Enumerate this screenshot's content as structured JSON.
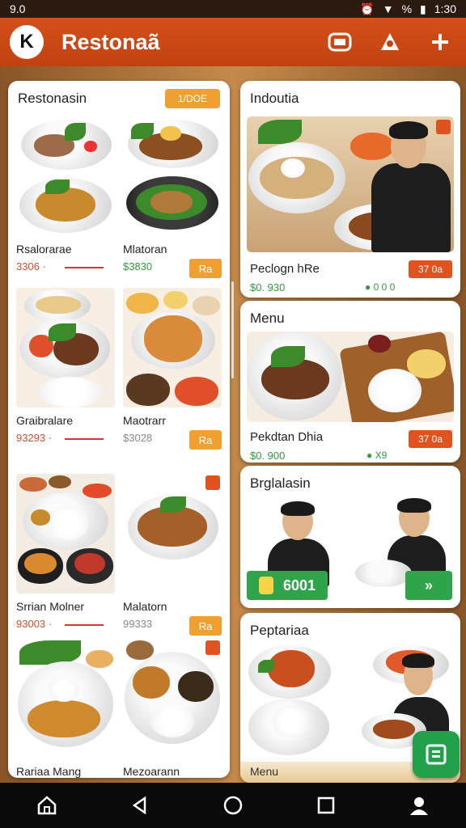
{
  "status": {
    "time": "1:30",
    "left_icons": "9.0",
    "battery": "%"
  },
  "appbar": {
    "title": "Restonaã",
    "logo_glyph": "K",
    "icons": [
      "cart-icon",
      "user-icon",
      "add-icon"
    ]
  },
  "left_panel": {
    "title": "Restonasin",
    "badge": "1/DOE",
    "items": [
      {
        "name": "Rsalorarae",
        "price": "3306 ·",
        "add": ""
      },
      {
        "name": "Mlatoran",
        "price": "$3830",
        "add": "Ra"
      },
      {
        "name": "Graibralare",
        "price": "93293 ·",
        "add": ""
      },
      {
        "name": "Maotrarr",
        "price": "$3028",
        "add": "Ra"
      },
      {
        "name": "Srrian Molner",
        "price": "93003 ·",
        "add": ""
      },
      {
        "name": "Malatorn",
        "price": "99333",
        "add": "Ra"
      },
      {
        "name": "Rariaa Mang",
        "price": "",
        "add": ""
      },
      {
        "name": "Mezoarann",
        "price": "",
        "add": ""
      }
    ]
  },
  "right_cards": [
    {
      "title": "Indoutia",
      "name": "Peclogn hRe",
      "price": "$0. 930",
      "meta": "● 0 0 0",
      "badge": "37 0a"
    },
    {
      "title": "Menu",
      "name": "Pekdtan Dhia",
      "price": "$0. 900",
      "meta": "● X9",
      "badge": "37 0a"
    },
    {
      "title": "Brglalasin",
      "button": "6001",
      "arrow": "»"
    },
    {
      "title": "Peptariaa",
      "footer": "Menu"
    }
  ],
  "colors": {
    "accent": "#c2410f",
    "badge": "#f0a030",
    "green": "#2fa44a"
  }
}
